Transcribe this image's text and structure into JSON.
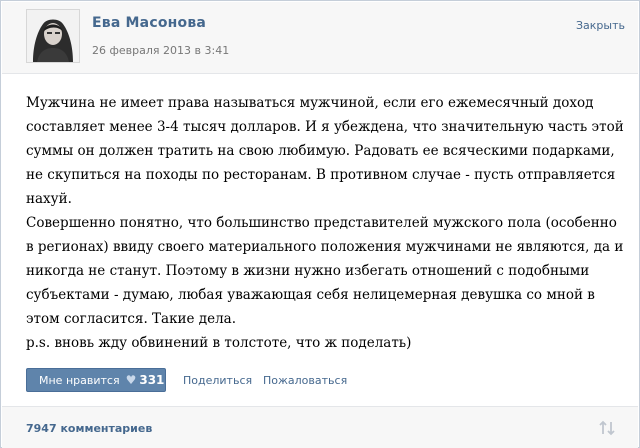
{
  "post": {
    "author_name": "Ева Масонова",
    "date": "26 февраля 2013 в 3:41",
    "close_label": "Закрыть",
    "body_lines": [
      "Мужчина не имеет права называться мужчиной, если его ежемесячный доход",
      "составляет менее 3-4 тысяч долларов. И я убеждена, что значительную часть этой",
      "суммы он должен тратить на свою любимую. Радовать ее всяческими подарками,",
      "не скупиться на походы по ресторанам. В противном случае - пусть отправляется",
      "нахуй.",
      "Совершенно понятно, что большинство представителей мужского пола (особенно",
      "в регионах) ввиду своего материального положения мужчинами не являются, да и",
      "никогда не станут. Поэтому в жизни нужно избегать отношений с подобными",
      "субъектами - думаю, любая уважающая себя нелицемерная девушка со мной в",
      "этом согласится. Такие дела.",
      "p.s. вновь жду обвинений в толстоте, что ж поделать)"
    ]
  },
  "actions": {
    "like_label": "Мне нравится",
    "like_count": "331",
    "share_label": "Поделиться",
    "report_label": "Пожаловаться"
  },
  "footer": {
    "comments_label": "7947 комментариев"
  },
  "icons": {
    "like": "heart-icon",
    "sort": "sort-arrows-icon",
    "avatar": "avatar-photo"
  },
  "colors": {
    "link": "#45688e",
    "like_button": "#5f84ab",
    "header_bg": "#f7f7f7"
  }
}
